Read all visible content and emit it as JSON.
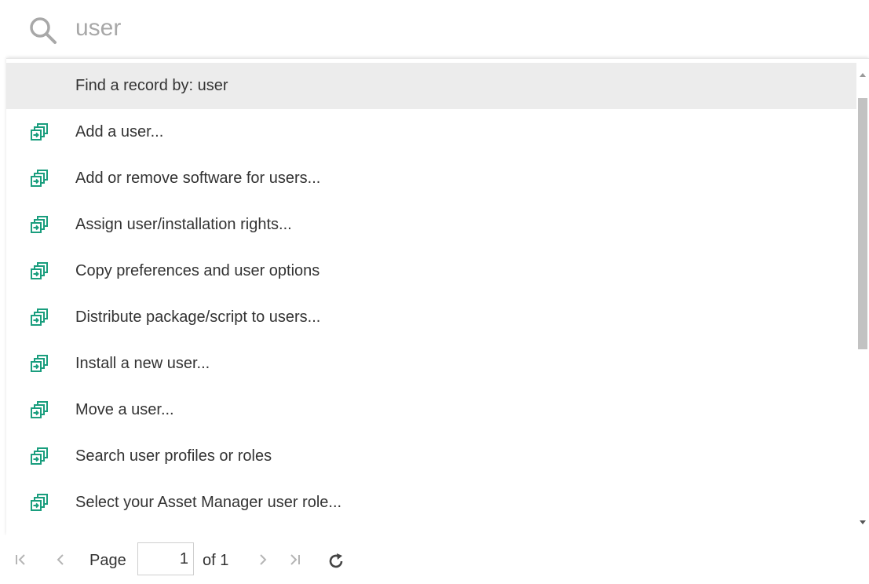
{
  "search": {
    "icon": "search-icon",
    "value": "user",
    "text_color": "#a8a8a8"
  },
  "results": {
    "highlight_color": "#ececec",
    "icon_color": "#1a9e7e",
    "items": [
      {
        "label": "Find a record by: user",
        "icon": null,
        "highlighted": true
      },
      {
        "label": "Add a user...",
        "icon": "workflow-icon"
      },
      {
        "label": "Add or remove software for users...",
        "icon": "workflow-icon"
      },
      {
        "label": "Assign user/installation rights...",
        "icon": "workflow-icon"
      },
      {
        "label": "Copy preferences and user options",
        "icon": "workflow-icon"
      },
      {
        "label": "Distribute package/script to users...",
        "icon": "workflow-icon"
      },
      {
        "label": "Install a new user...",
        "icon": "workflow-icon"
      },
      {
        "label": "Move a user...",
        "icon": "workflow-icon"
      },
      {
        "label": "Search user profiles or roles",
        "icon": "workflow-icon"
      },
      {
        "label": "Select your Asset Manager user role...",
        "icon": "workflow-icon"
      }
    ]
  },
  "pager": {
    "first_icon": "first-page-icon",
    "prev_icon": "previous-page-icon",
    "next_icon": "next-page-icon",
    "last_icon": "last-page-icon",
    "refresh_icon": "refresh-icon",
    "page_label": "Page",
    "current_page": "1",
    "of_label": "of 1"
  }
}
